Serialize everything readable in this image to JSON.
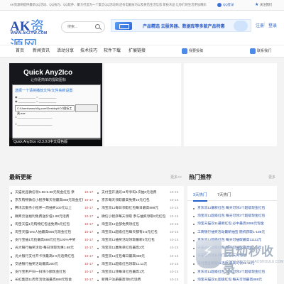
{
  "topbar": {
    "text": "AK资源网提供最新QQ活动、QQ技巧、QQ软件、聚力打造为一个集全QQ活动网,还有电脑技巧以及将后生活信息 新技术品 让你们的生活更加精彩",
    "login": "QQ登录",
    "favorite": "关注我们"
  },
  "logo": {
    "main_a": "AK",
    "main_cn": "资源网",
    "sub": "WWW.AKZYW.COM"
  },
  "search": {
    "placeholder": "搜索..."
  },
  "banner": {
    "text": "产品精选 云服务器、数据库等多款产品特惠"
  },
  "auth": {
    "register": "注册",
    "login": "登录"
  },
  "nav": {
    "items": [
      "首页",
      "新闻资讯",
      "活动分享",
      "技术技巧",
      "软件下载",
      "扩展链接"
    ],
    "profile": "我要投稿",
    "contact": "联系我们"
  },
  "feature": {
    "title": "Quick Any2Ico",
    "subtitle": "让你更简单的提取图标",
    "hint": "选择一个请将播放文件/文件夹新设置",
    "path": "C:\\Users\\www.k5g.com\\Desktop\\ICO图标工具.exe",
    "caption": "Quick Any2Ico v3.3.0.0中文绿色版"
  },
  "latest": {
    "title": "最新更新",
    "more": "更多>>",
    "left_rows": [
      {
        "title": "天猫优品微信领1.88-5.88元现金红包 亲",
        "date": "10-17"
      },
      {
        "title": "京东购物微信小程序每天领最高888元现金红包",
        "date": "10-17"
      },
      {
        "title": "腾讯云服务小程序一周抽奖100元以上",
        "date": "10-17"
      },
      {
        "title": "微商云送福利免费送价值1.88元话费",
        "date": "10-17"
      },
      {
        "title": "淘宝天猫1元购物红包送免费5元红包",
        "date": "10-17"
      },
      {
        "title": "淘宝天猫new人抽最高666元现金红包",
        "date": "10-17"
      },
      {
        "title": "支付宝抽1元抢最高888元红包100%中奖",
        "date": "10-17"
      },
      {
        "title": "光大银行抽奖活动-每日领取优惠1.88元",
        "date": "10-17"
      },
      {
        "title": "光大银行支付开卡领最高5-6元话费红包",
        "date": "10-17"
      },
      {
        "title": "交通银行抽奖活动最高200元",
        "date": "10-17"
      },
      {
        "title": "支付宝用户扫一扫领小额现金红包",
        "date": "10-17"
      },
      {
        "title": "长虹集团11周年活动送最高888元现金",
        "date": "10-17"
      }
    ],
    "right_rows": [
      {
        "title": "支付宝开通双11专享码1次抽3元话费",
        "date": "10-15"
      },
      {
        "title": "京东每天领取最高免费10元红包",
        "date": "10-15"
      },
      {
        "title": "淘宝双11每日领取红包每日最高888元",
        "date": "10-15"
      },
      {
        "title": "微信小程序每天领取 参与抽奖领取8元红包",
        "date": "10-15"
      },
      {
        "title": "淘宝双11全部免费领红包",
        "date": "10-15"
      },
      {
        "title": "淘宝双11超级红包每天都有0.5元红包",
        "date": "10-15"
      },
      {
        "title": "淘宝双11抽奖活动领取最新5元红包",
        "date": "10-15"
      },
      {
        "title": "淘宝双11赢免单红包最高2元",
        "date": "10-15"
      },
      {
        "title": "淘宝双11红包每日最高888元",
        "date": "10-15"
      },
      {
        "title": "淘宝双11超级红包领取11.11元",
        "date": "10-15"
      },
      {
        "title": "淘宝双11领每日红包最高1元",
        "date": "10-15"
      },
      {
        "title": "新用户注册最高领5元话费",
        "date": "10-15"
      }
    ]
  },
  "hot": {
    "title": "热门推荐",
    "more": "更多",
    "tabs": [
      "3天热门",
      "7天热门"
    ],
    "rows": [
      "京东双11最新红包 每天可领3个超级现金红包",
      "淘宝双11超级红包 每天可领3个超级现金红包",
      "淘宝天猫双11最新红包 必中最高2888元现金",
      "工商银行抽奖活动最新抽签 随机获取1-188元",
      "京东双11超级红包 每天可抽取最高11111元",
      "天猫双11超级红包 每天可抽取最高11111元",
      "天猫超市双11开门红包 天天可领",
      "支付宝全新双11活动 最高可领11.11元",
      "京东双11超级红包 每天可领3个超级现金红包",
      "淘宝天猫双11超级红包 每天可领最高888元"
    ]
  },
  "watermark": {
    "title": "自动秒收录",
    "sub": "WWW.ZIDONGMIAOSHOULU.COM"
  }
}
